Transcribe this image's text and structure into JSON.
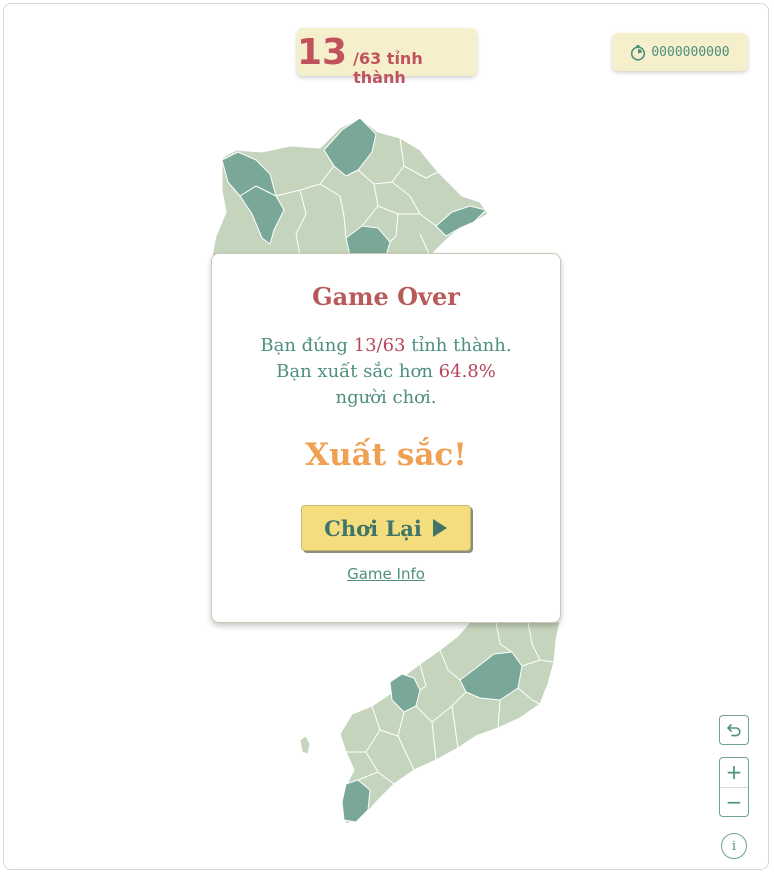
{
  "header": {
    "score": "13",
    "score_total": "/63 tỉnh thành",
    "timer": "0000000000",
    "timer_icon": "stopwatch-icon"
  },
  "modal": {
    "title": "Game Over",
    "line1_prefix": "Bạn đúng ",
    "line1_value": "13/63",
    "line1_suffix": " tỉnh thành.",
    "line2_prefix": "Bạn xuất sắc hơn ",
    "line2_value": "64.8%",
    "line3": "người chơi.",
    "rating": "Xuất sắc!",
    "play_again": "Chơi Lại",
    "game_info": "Game Info"
  },
  "controls": {
    "undo_icon": "undo-icon",
    "zoom_in": "+",
    "zoom_out": "−",
    "info": "i"
  },
  "colors": {
    "province_default": "#c5d5bd",
    "province_correct": "#7aa898",
    "province_border": "#ffffff",
    "accent_red": "#b95a5a",
    "accent_teal": "#4e8f80",
    "rating_orange": "#f0a052",
    "panel_yellow": "#f6efcb",
    "button_yellow": "#f3dd7c"
  },
  "game": {
    "correct_provinces": 13,
    "total_provinces": 63
  }
}
